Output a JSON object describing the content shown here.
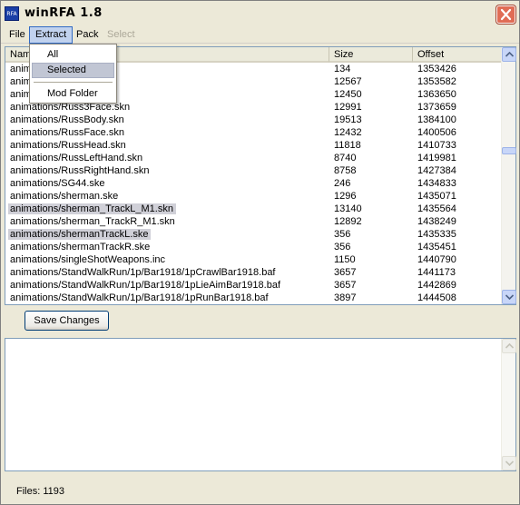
{
  "window": {
    "title": "winRFA 1.8",
    "app_icon_label": "RFA"
  },
  "menubar": {
    "items": [
      "File",
      "Extract",
      "Pack",
      "Select"
    ]
  },
  "extract_menu": {
    "items": [
      "All",
      "Selected",
      "Mod Folder"
    ]
  },
  "table": {
    "columns": [
      "Name",
      "Size",
      "Offset"
    ],
    "rows": [
      {
        "name": "animations/Russ...ke",
        "size": "134",
        "offset": "1353426",
        "selected": false
      },
      {
        "name": "animations/Russ...kn",
        "size": "12567",
        "offset": "1353582",
        "selected": false
      },
      {
        "name": "animations/Russ...kn",
        "size": "12450",
        "offset": "1363650",
        "selected": false
      },
      {
        "name": "animations/Russ3Face.skn",
        "size": "12991",
        "offset": "1373659",
        "selected": false
      },
      {
        "name": "animations/RussBody.skn",
        "size": "19513",
        "offset": "1384100",
        "selected": false
      },
      {
        "name": "animations/RussFace.skn",
        "size": "12432",
        "offset": "1400506",
        "selected": false
      },
      {
        "name": "animations/RussHead.skn",
        "size": "11818",
        "offset": "1410733",
        "selected": false
      },
      {
        "name": "animations/RussLeftHand.skn",
        "size": "8740",
        "offset": "1419981",
        "selected": false
      },
      {
        "name": "animations/RussRightHand.skn",
        "size": "8758",
        "offset": "1427384",
        "selected": false
      },
      {
        "name": "animations/SG44.ske",
        "size": "246",
        "offset": "1434833",
        "selected": false
      },
      {
        "name": "animations/sherman.ske",
        "size": "1296",
        "offset": "1435071",
        "selected": false
      },
      {
        "name": "animations/sherman_TrackL_M1.skn",
        "size": "13140",
        "offset": "1435564",
        "selected": true
      },
      {
        "name": "animations/sherman_TrackR_M1.skn",
        "size": "12892",
        "offset": "1438249",
        "selected": false
      },
      {
        "name": "animations/shermanTrackL.ske",
        "size": "356",
        "offset": "1435335",
        "selected": true
      },
      {
        "name": "animations/shermanTrackR.ske",
        "size": "356",
        "offset": "1435451",
        "selected": false
      },
      {
        "name": "animations/singleShotWeapons.inc",
        "size": "1150",
        "offset": "1440790",
        "selected": false
      },
      {
        "name": "animations/StandWalkRun/1p/Bar1918/1pCrawlBar1918.baf",
        "size": "3657",
        "offset": "1441173",
        "selected": false
      },
      {
        "name": "animations/StandWalkRun/1p/Bar1918/1pLieAimBar1918.baf",
        "size": "3657",
        "offset": "1442869",
        "selected": false
      },
      {
        "name": "animations/StandWalkRun/1p/Bar1918/1pRunBar1918.baf",
        "size": "3897",
        "offset": "1444508",
        "selected": false
      }
    ]
  },
  "buttons": {
    "save_changes": "Save Changes"
  },
  "status": {
    "files_text": "Files: 1193"
  }
}
